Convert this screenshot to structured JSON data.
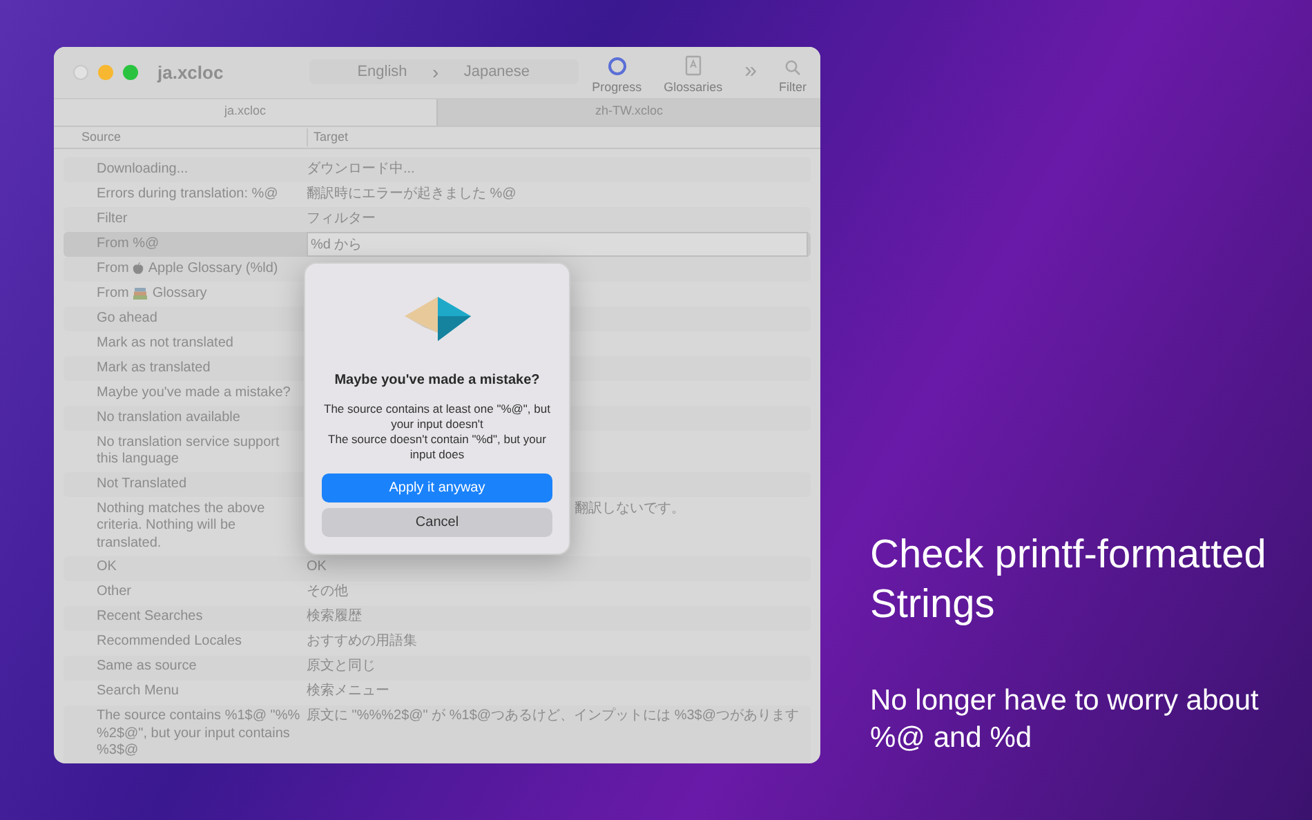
{
  "window": {
    "title": "ja.xcloc",
    "traffic_lights": [
      {
        "kind": "close",
        "active": false
      },
      {
        "kind": "minimize",
        "active": true
      },
      {
        "kind": "zoom",
        "active": true
      }
    ]
  },
  "languages": {
    "from": "English",
    "separator": "›",
    "to": "Japanese"
  },
  "toolbar": [
    {
      "kind": "progress",
      "label": "Progress"
    },
    {
      "kind": "glossaries",
      "label": "Glossaries"
    },
    {
      "kind": "more",
      "label": "»"
    },
    {
      "kind": "filter",
      "label": "Filter"
    }
  ],
  "tabs": [
    {
      "label": "ja.xcloc",
      "selected": true
    },
    {
      "label": "zh-TW.xcloc",
      "selected": false
    }
  ],
  "table": {
    "columns": [
      "Source",
      "Target"
    ],
    "rows": [
      {
        "source": "Downloading...",
        "target": "ダウンロード中...",
        "selected": false
      },
      {
        "source": "Errors during translation: %@",
        "target": "翻訳時にエラーが起きました %@",
        "selected": false
      },
      {
        "source": "Filter",
        "target": "フィルター",
        "selected": false
      },
      {
        "source": "From %@",
        "target": "%d から",
        "selected": true,
        "editing": true
      },
      {
        "source": "From",
        "kind": "apple",
        "source_after": "Apple Glossary (%ld)",
        "selected": false
      },
      {
        "source": "From",
        "kind": "books",
        "source_after": "Glossary",
        "selected": false
      },
      {
        "source": "Go ahead",
        "selected": false
      },
      {
        "source": "Mark as not translated",
        "selected": false
      },
      {
        "source": "Mark as translated",
        "selected": false
      },
      {
        "source": "Maybe you've made a mistake?",
        "selected": false
      },
      {
        "source": "No translation available",
        "selected": false
      },
      {
        "source": "No translation service support this language",
        "selected": false
      },
      {
        "source": "Not Translated",
        "selected": false
      },
      {
        "source": "Nothing matches the above criteria. Nothing will be translated.",
        "target": "翻訳しないです。",
        "target_covered": true,
        "selected": false
      },
      {
        "source": "OK",
        "target": "OK",
        "selected": false
      },
      {
        "source": "Other",
        "target": "その他",
        "selected": false
      },
      {
        "source": "Recent Searches",
        "target": "検索履歴",
        "selected": false
      },
      {
        "source": "Recommended Locales",
        "target": "おすすめの用語集",
        "selected": false
      },
      {
        "source": "Same as source",
        "target": "原文と同じ",
        "selected": false
      },
      {
        "source": "Search Menu",
        "target": "検索メニュー",
        "selected": false
      },
      {
        "source": "The source contains %1$@ \"%% %2$@\", but your input contains %3$@",
        "target": "原文に \"%%%2$@\" が %1$@つあるけど、インプットには %3$@つがあります",
        "selected": false
      }
    ]
  },
  "dialog": {
    "title": "Maybe you've made a mistake?",
    "messages": [
      "The source contains at least one \"%@\", but your input doesn't",
      "The source doesn't contain \"%d\", but your input does"
    ],
    "buttons": [
      {
        "label": "Apply it anyway",
        "kind": "primary"
      },
      {
        "label": "Cancel",
        "kind": "secondary"
      }
    ]
  },
  "promo": {
    "headline": "Check printf-formatted Strings",
    "subline": "No longer have to worry about %@ and %d"
  }
}
